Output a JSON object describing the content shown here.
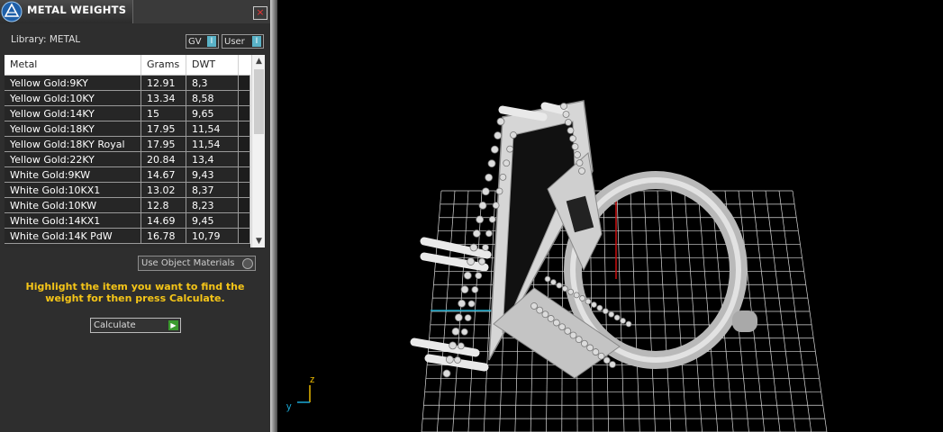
{
  "panel": {
    "title": "METAL WEIGHTS",
    "close_glyph": "×",
    "library_label": "Library: METAL",
    "toggles": [
      {
        "label": "GV",
        "indicator": "I"
      },
      {
        "label": "User",
        "indicator": "I"
      }
    ],
    "table": {
      "columns": [
        "Metal",
        "Grams",
        "DWT"
      ],
      "rows": [
        {
          "metal": "Yellow Gold:9KY",
          "grams": "12.91",
          "dwt": "8,3"
        },
        {
          "metal": "Yellow Gold:10KY",
          "grams": "13.34",
          "dwt": "8,58"
        },
        {
          "metal": "Yellow Gold:14KY",
          "grams": "15",
          "dwt": "9,65"
        },
        {
          "metal": "Yellow Gold:18KY",
          "grams": "17.95",
          "dwt": "11,54"
        },
        {
          "metal": "Yellow Gold:18KY Royal",
          "grams": "17.95",
          "dwt": "11,54"
        },
        {
          "metal": "Yellow Gold:22KY",
          "grams": "20.84",
          "dwt": "13,4"
        },
        {
          "metal": "White Gold:9KW",
          "grams": "14.67",
          "dwt": "9,43"
        },
        {
          "metal": "White Gold:10KX1",
          "grams": "13.02",
          "dwt": "8,37"
        },
        {
          "metal": "White Gold:10KW",
          "grams": "12.8",
          "dwt": "8,23"
        },
        {
          "metal": "White Gold:14KX1",
          "grams": "14.69",
          "dwt": "9,45"
        },
        {
          "metal": "White Gold:14K PdW",
          "grams": "16.78",
          "dwt": "10,79"
        }
      ],
      "scroll_up": "▲",
      "scroll_down": "▼"
    },
    "use_object_materials_label": "Use Object Materials",
    "hint_text": "Highlight the item you want to find the weight for then press Calculate.",
    "calculate_label": "Calculate",
    "calculate_glyph": "▶"
  },
  "viewport": {
    "axis_z_label": "z",
    "axis_y_label": "y"
  },
  "colors": {
    "panel_bg": "#2e2e2e",
    "hint": "#f5c518",
    "toggle_indicator": "#5ab3c8",
    "calculate_go": "#3a9a2d",
    "viewport_bg": "#000000",
    "grid": "#d8d8d8",
    "axis_red": "#cc1111",
    "axis_cyan": "#18a7c9",
    "ring": "#c8c8c8"
  }
}
